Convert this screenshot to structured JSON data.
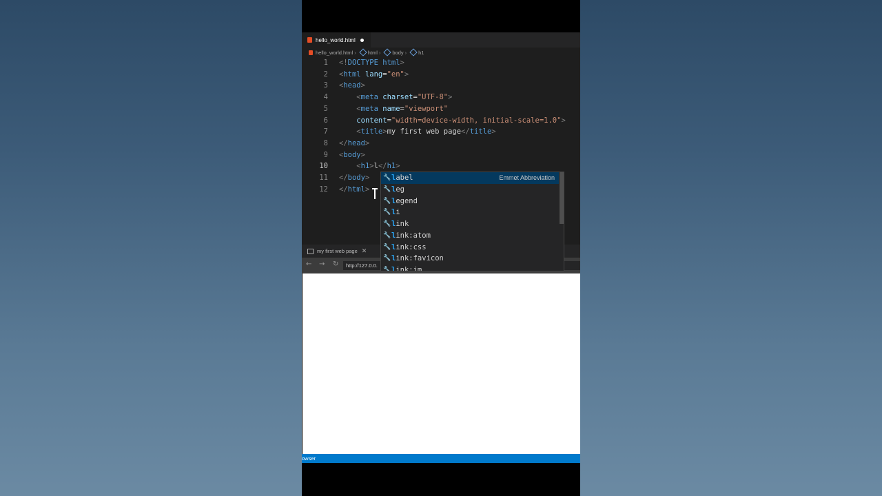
{
  "editor": {
    "tab_label": "hello_world.html",
    "breadcrumb": [
      "hello_world.html",
      "html",
      "body",
      "h1"
    ],
    "active_line": "10",
    "lines": [
      {
        "n": "1",
        "tokens": [
          [
            "p",
            "<!"
          ],
          [
            "dt",
            "DOCTYPE"
          ],
          [
            "t",
            " "
          ],
          [
            "tag",
            "html"
          ],
          [
            "p",
            ">"
          ]
        ]
      },
      {
        "n": "2",
        "tokens": [
          [
            "p",
            "<"
          ],
          [
            "tag",
            "html"
          ],
          [
            "t",
            " "
          ],
          [
            "attr",
            "lang"
          ],
          [
            "t",
            "="
          ],
          [
            "str",
            "\"en\""
          ],
          [
            "p",
            ">"
          ]
        ]
      },
      {
        "n": "3",
        "tokens": [
          [
            "p",
            "<"
          ],
          [
            "tag",
            "head"
          ],
          [
            "p",
            ">"
          ]
        ]
      },
      {
        "n": "4",
        "tokens": [
          [
            "t",
            "    "
          ],
          [
            "p",
            "<"
          ],
          [
            "tag",
            "meta"
          ],
          [
            "t",
            " "
          ],
          [
            "attr",
            "charset"
          ],
          [
            "t",
            "="
          ],
          [
            "str",
            "\"UTF-8\""
          ],
          [
            "p",
            ">"
          ]
        ]
      },
      {
        "n": "5",
        "tokens": [
          [
            "t",
            "    "
          ],
          [
            "p",
            "<"
          ],
          [
            "tag",
            "meta"
          ],
          [
            "t",
            " "
          ],
          [
            "attr",
            "name"
          ],
          [
            "t",
            "="
          ],
          [
            "str",
            "\"viewport\""
          ]
        ]
      },
      {
        "n": "6",
        "tokens": [
          [
            "t",
            "    "
          ],
          [
            "attr",
            "content"
          ],
          [
            "t",
            "="
          ],
          [
            "str",
            "\"width=device-width, initial-scale=1.0\""
          ],
          [
            "p",
            ">"
          ]
        ]
      },
      {
        "n": "7",
        "tokens": [
          [
            "t",
            "    "
          ],
          [
            "p",
            "<"
          ],
          [
            "tag",
            "title"
          ],
          [
            "p",
            ">"
          ],
          [
            "t",
            "my first web page"
          ],
          [
            "p",
            "</"
          ],
          [
            "tag",
            "title"
          ],
          [
            "p",
            ">"
          ]
        ]
      },
      {
        "n": "8",
        "tokens": [
          [
            "p",
            "</"
          ],
          [
            "tag",
            "head"
          ],
          [
            "p",
            ">"
          ]
        ]
      },
      {
        "n": "9",
        "tokens": [
          [
            "p",
            "<"
          ],
          [
            "tag",
            "body"
          ],
          [
            "p",
            ">"
          ]
        ]
      },
      {
        "n": "10",
        "tokens": [
          [
            "t",
            "    "
          ],
          [
            "p",
            "<"
          ],
          [
            "tag",
            "h1"
          ],
          [
            "p",
            ">"
          ],
          [
            "t",
            "l"
          ],
          [
            "p",
            "</"
          ],
          [
            "tag",
            "h1"
          ],
          [
            "p",
            ">"
          ]
        ]
      },
      {
        "n": "11",
        "tokens": [
          [
            "p",
            "</"
          ],
          [
            "tag",
            "body"
          ],
          [
            "p",
            ">"
          ]
        ]
      },
      {
        "n": "12",
        "tokens": [
          [
            "p",
            "</"
          ],
          [
            "tag",
            "html"
          ],
          [
            "p",
            ">"
          ]
        ]
      }
    ]
  },
  "suggest": {
    "detail": "Emmet Abbreviation",
    "items": [
      {
        "match": "l",
        "rest": "abel"
      },
      {
        "match": "l",
        "rest": "eg"
      },
      {
        "match": "l",
        "rest": "egend"
      },
      {
        "match": "l",
        "rest": "i"
      },
      {
        "match": "l",
        "rest": "ink"
      },
      {
        "match": "l",
        "rest": "ink:atom"
      },
      {
        "match": "l",
        "rest": "ink:css"
      },
      {
        "match": "l",
        "rest": "ink:favicon"
      },
      {
        "match": "l",
        "rest": "ink:im"
      }
    ]
  },
  "browser": {
    "tab_label": "my first web page",
    "url": "http://127.0.0."
  },
  "statusbar": {
    "text": "owser"
  }
}
